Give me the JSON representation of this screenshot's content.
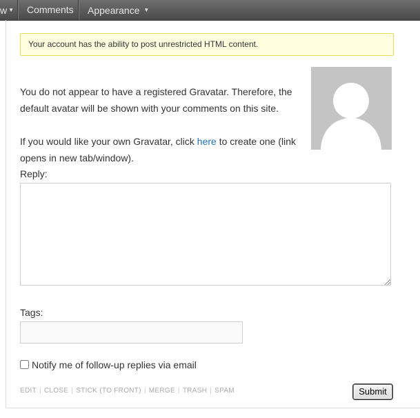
{
  "topbar": {
    "menu": [
      {
        "label": "w",
        "has_caret": true
      },
      {
        "label": "Comments",
        "has_caret": false
      },
      {
        "label": "Appearance",
        "has_caret": true
      }
    ]
  },
  "notice": {
    "text": "Your account has the ability to post unrestricted HTML content."
  },
  "gravatar": {
    "paragraph1": "You do not appear to have a registered Gravatar. Therefore, the default avatar will be shown with your comments on this site.",
    "paragraph2_prefix": "If you would like your own Gravatar, click ",
    "link_text": "here",
    "paragraph2_suffix": " to create one (link opens in new tab/window).",
    "avatar_icon": "default-avatar-silhouette"
  },
  "form": {
    "reply_label": "Reply:",
    "reply_value": "",
    "tags_label": "Tags:",
    "tags_value": "",
    "notify_label": "Notify me of follow-up replies via email",
    "notify_checked": false,
    "submit_label": "Submit"
  },
  "actions": [
    "EDIT",
    "CLOSE",
    "STICK",
    "(TO FRONT)",
    "MERGE",
    "TRASH",
    "SPAM"
  ],
  "colors": {
    "link": "#1e73be",
    "notice_bg": "#ffffe0",
    "notice_border": "#e6db55",
    "topbar": "#555555"
  }
}
